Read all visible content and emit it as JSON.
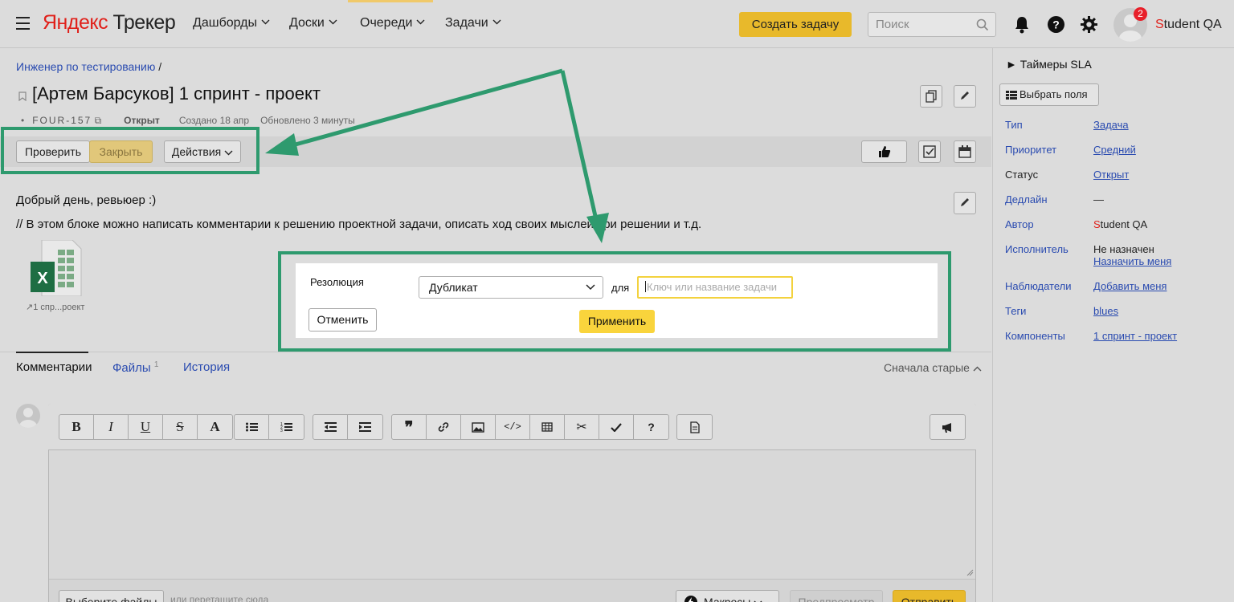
{
  "header": {
    "logo_part1": "Яндекс",
    "logo_part2": "Трекер",
    "nav": [
      "Дашборды",
      "Доски",
      "Очереди",
      "Задачи"
    ],
    "create_label": "Создать задачу",
    "search_placeholder": "Поиск",
    "notifications_count": "2",
    "user_initial": "S",
    "user_rest": "tudent QA"
  },
  "issue": {
    "breadcrumb": "Инженер по тестированию",
    "breadcrumb_sep": "/",
    "title": "[Артем Барсуков] 1 спринт - проект",
    "key": "FOUR-157",
    "status": "Открыт",
    "created": "Создано 18 апр",
    "updated": "Обновлено 3 минуты"
  },
  "toolbar": {
    "check_label": "Проверить",
    "close_label": "Закрыть",
    "actions_label": "Действия"
  },
  "description": {
    "line1": "Добрый день, ревьюер :)",
    "line2": "// В этом блоке можно написать комментарии к решению проектной задачи, описать ход своих мыслей при решении и т.д.",
    "attachment_name": "1 спр...роект"
  },
  "resolution_popup": {
    "label": "Резолюция",
    "selected": "Дубликат",
    "for_label": "для",
    "key_placeholder": "Ключ или название задачи",
    "cancel_label": "Отменить",
    "apply_label": "Применить"
  },
  "tabs": {
    "comments": "Комментарии",
    "files": "Файлы",
    "files_count": "1",
    "history": "История",
    "sort_label": "Сначала старые"
  },
  "editor": {
    "choose_files": "Выберите файлы",
    "drag_hint": "или перетащите сюда",
    "macros": "Макросы",
    "preview": "Предпросмотр",
    "send": "Отправить"
  },
  "sidebar": {
    "sla_timers": "► Таймеры SLA",
    "choose_fields": "Выбрать поля",
    "fields": [
      {
        "label": "Тип",
        "value": "Задача"
      },
      {
        "label": "Приоритет",
        "value": "Средний"
      },
      {
        "label": "Статус",
        "value": "Открыт"
      },
      {
        "label": "Дедлайн",
        "value": "—"
      },
      {
        "label": "Автор",
        "value_initial": "S",
        "value_rest": "tudent QA"
      },
      {
        "label": "Исполнитель",
        "value": "Не назначен",
        "value2": "Назначить меня"
      },
      {
        "label": "Наблюдатели",
        "value": "Добавить меня"
      },
      {
        "label": "Теги",
        "value": "blues"
      },
      {
        "label": "Компоненты",
        "value": "1 спринт - проект"
      }
    ]
  },
  "colors": {
    "accent_yellow": "#e8b92b",
    "annotation_green": "#2e9a6e",
    "link_blue": "#2a4bb0",
    "brand_red": "#e0201a"
  }
}
